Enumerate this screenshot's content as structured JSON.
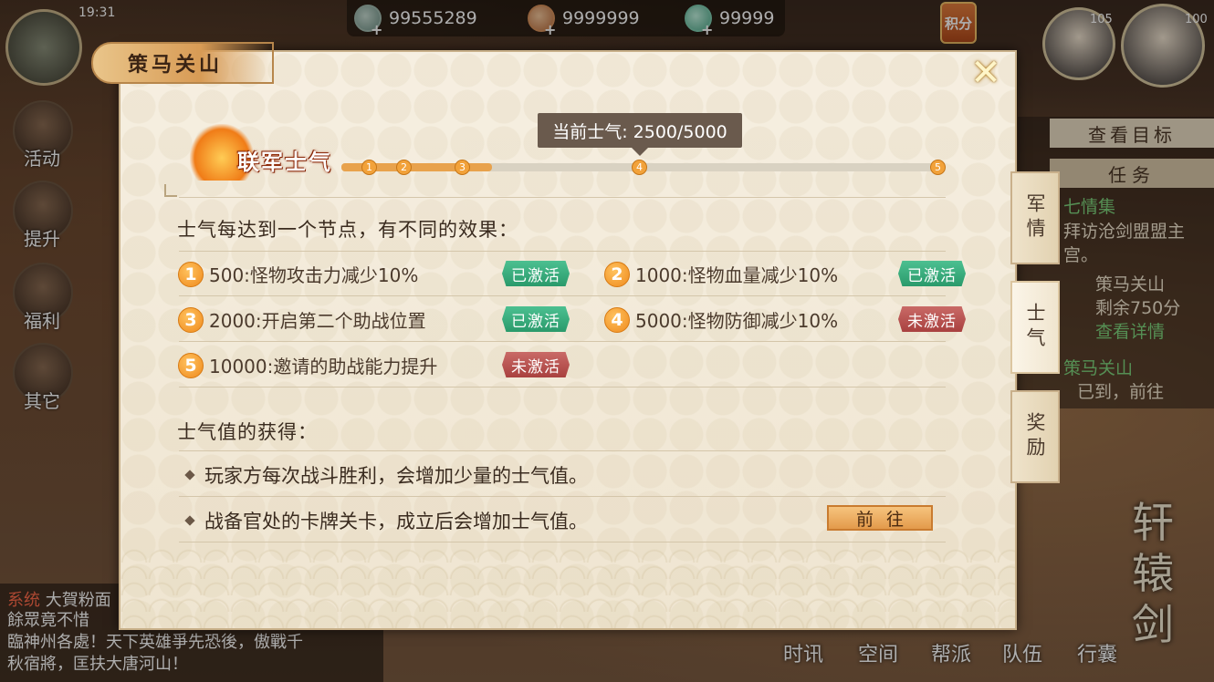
{
  "hud": {
    "time": "19:31",
    "currencies": [
      {
        "icon": "jade-coin-icon",
        "value": "99555289"
      },
      {
        "icon": "copper-coin-icon",
        "value": "9999999"
      },
      {
        "icon": "green-gem-icon",
        "value": "99999"
      }
    ],
    "jifen_label": "积分",
    "avatar_levels": [
      "105",
      "100"
    ],
    "left_menu": [
      "活动",
      "提升",
      "福利",
      "其它"
    ],
    "bottom_menu": [
      "时讯",
      "空间",
      "帮派",
      "队伍",
      "行囊"
    ],
    "right_panel": {
      "target_label": "查看目标",
      "task_label": "任务",
      "lines": [
        "七情集",
        "拜访沧剑盟盟主",
        "宫。",
        "策马关山",
        "剩余750分",
        "查看详情",
        "策马关山",
        "已到，前往"
      ],
      "accent": "#7ed37d"
    },
    "chat": {
      "channel": "系统",
      "lines": [
        "大賀粉面",
        "餘眾竟不惜",
        "臨神州各處！天下英雄爭先恐後，傲戰千",
        "秋宿將，匡扶大唐河山！"
      ]
    },
    "logo_text": "轩辕剑"
  },
  "modal": {
    "title": "策马关山",
    "close_label": "✕",
    "morale": {
      "label": "联军士气",
      "tooltip": "当前士气: 2500/5000",
      "current": 2500,
      "max": 5000,
      "fill_fraction": 0.25,
      "nodes": [
        "1",
        "2",
        "3",
        "4",
        "5"
      ]
    },
    "effects_title": "士气每达到一个节点，有不同的效果：",
    "effects": [
      {
        "num": "1",
        "text": "500:怪物攻击力减少10%",
        "status": "已激活",
        "active": true
      },
      {
        "num": "2",
        "text": "1000:怪物血量减少10%",
        "status": "已激活",
        "active": true
      },
      {
        "num": "3",
        "text": "2000:开启第二个助战位置",
        "status": "已激活",
        "active": true
      },
      {
        "num": "4",
        "text": "5000:怪物防御减少10%",
        "status": "未激活",
        "active": false
      },
      {
        "num": "5",
        "text": "10000:邀请的助战能力提升",
        "status": "未激活",
        "active": false
      }
    ],
    "gain_title": "士气值的获得：",
    "gains": [
      "玩家方每次战斗胜利，会增加少量的士气值。",
      "战备官处的卡牌关卡，成立后会增加士气值。"
    ],
    "goto_label": "前往",
    "side_tabs": [
      "军情",
      "士气",
      "奖励"
    ],
    "active_tab": "士气",
    "colors": {
      "active_badge": "#2a9a6b",
      "inactive_badge": "#a9413f",
      "progress": "#e8a24c"
    }
  }
}
